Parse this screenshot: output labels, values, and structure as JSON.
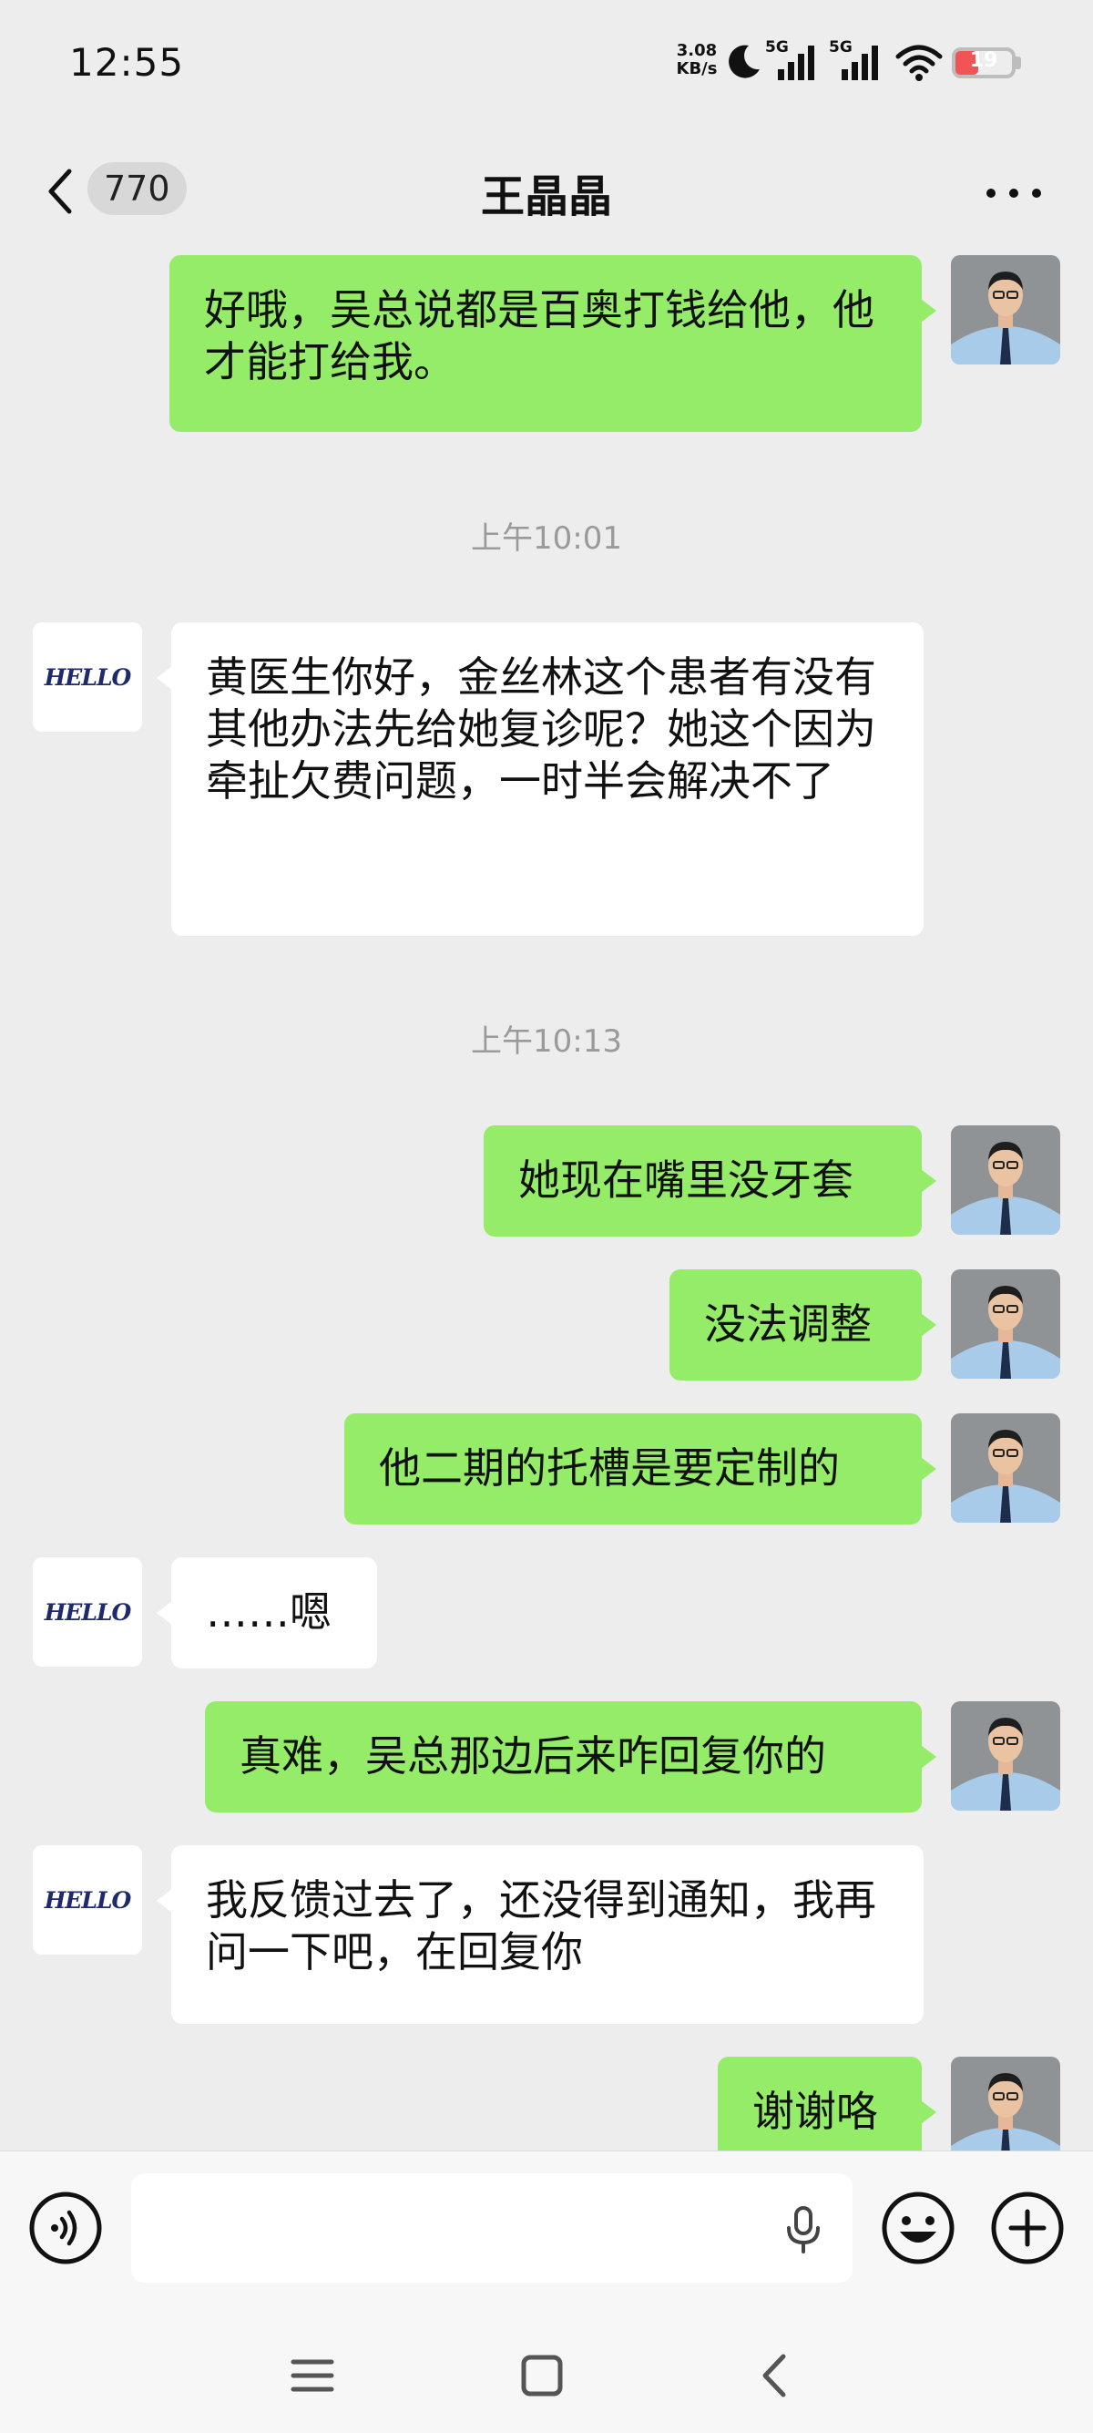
{
  "status_bar": {
    "time": "12:55",
    "net_speed_value": "3.08",
    "net_speed_unit": "KB/s",
    "sim1_label": "5G",
    "sim2_label": "5G",
    "battery_level": "19",
    "battery_color": "#f05454"
  },
  "header": {
    "title": "王晶晶",
    "unread_count": "770",
    "back_icon": "chevron-left-icon",
    "more_icon": "more-dots-icon"
  },
  "avatars": {
    "self": "man-in-blue-shirt-photo",
    "contact_text": "HELLO"
  },
  "messages": {
    "m1": {
      "from": "me",
      "text": "好哦，吴总说都是百奥打钱给他，他才能打给我。"
    },
    "ts1": "上午10:01",
    "m2": {
      "from": "contact",
      "text": "黄医生你好，金丝林这个患者有没有其他办法先给她复诊呢？她这个因为牵扯欠费问题，一时半会解决不了"
    },
    "ts2": "上午10:13",
    "m3": {
      "from": "me",
      "text": "她现在嘴里没牙套"
    },
    "m4": {
      "from": "me",
      "text": "没法调整"
    },
    "m5": {
      "from": "me",
      "text": "他二期的托槽是要定制的"
    },
    "m6": {
      "from": "contact",
      "text": "……嗯"
    },
    "m7": {
      "from": "me",
      "text": "真难，吴总那边后来咋回复你的"
    },
    "m8": {
      "from": "contact",
      "text": "我反馈过去了，还没得到通知，我再问一下吧，在回复你"
    },
    "m9": {
      "from": "me",
      "text": "谢谢咯"
    }
  },
  "input_bar": {
    "value": "",
    "placeholder": "",
    "voice_icon": "voice-mode-icon",
    "mic_icon": "microphone-icon",
    "emoji_icon": "emoji-smile-icon",
    "plus_icon": "plus-circle-icon"
  },
  "colors": {
    "outgoing_bubble": "#95ec69",
    "incoming_bubble": "#ffffff",
    "chat_background": "#ededed"
  },
  "nav_bar": {
    "menu_icon": "menu-icon",
    "home_icon": "home-square-icon",
    "back_icon": "back-triangle-icon"
  }
}
